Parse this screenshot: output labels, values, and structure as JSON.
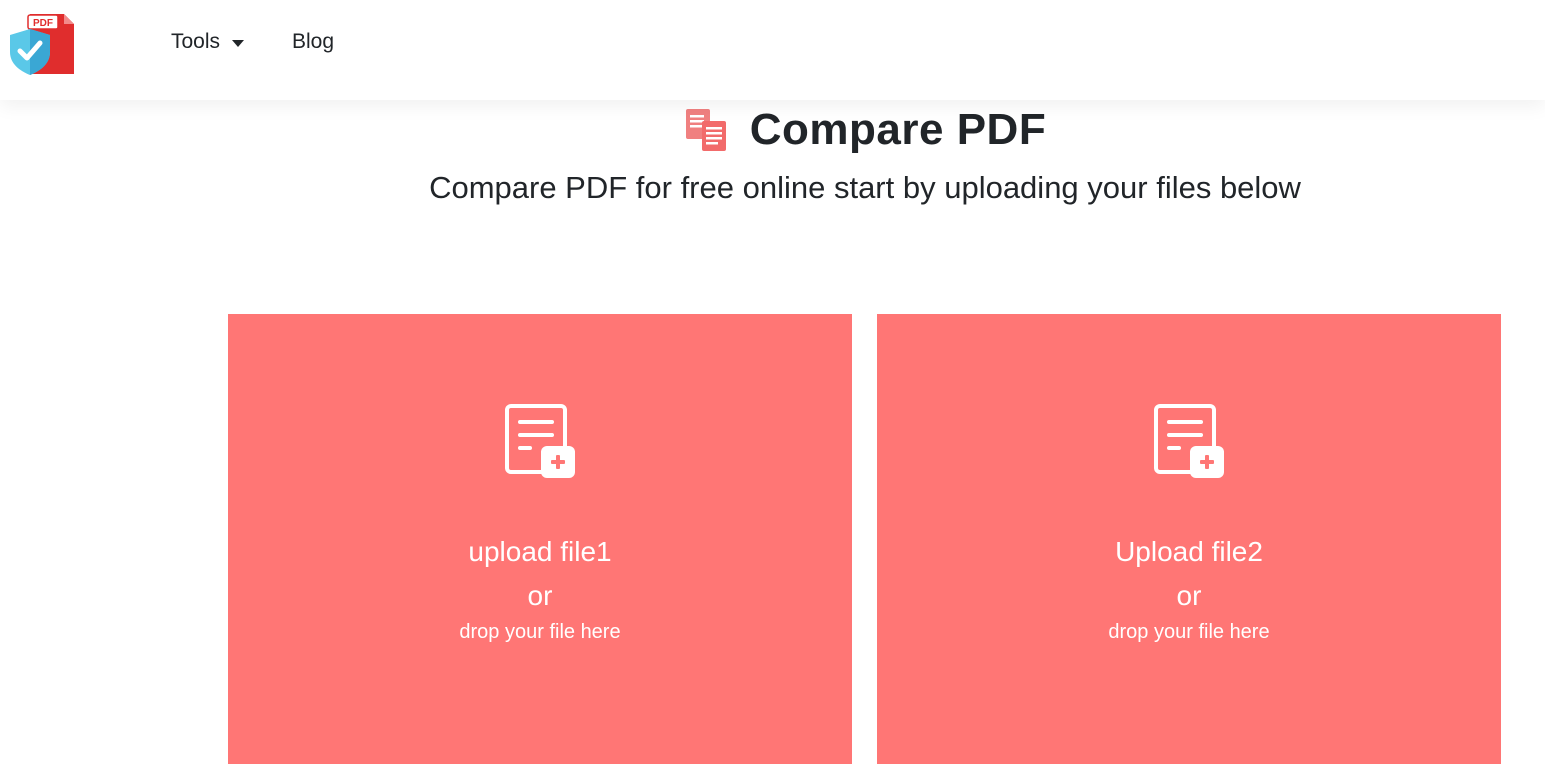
{
  "nav": {
    "logo_text": "PDF",
    "tools_label": "Tools",
    "blog_label": "Blog"
  },
  "header": {
    "title": "Compare PDF",
    "subtitle": "Compare PDF for free online start by uploading your files below"
  },
  "uploads": [
    {
      "label": "upload file1",
      "or": "or",
      "drop": "drop your file here"
    },
    {
      "label": "Upload file2",
      "or": "or",
      "drop": "drop your file here"
    }
  ],
  "colors": {
    "accent": "#ff7675",
    "logo_red": "#e02d2d",
    "shield_blue": "#5ac8e8"
  },
  "icons": {
    "logo": "pdf-shield-icon",
    "tools_caret": "caret-down-icon",
    "title": "copy-documents-icon",
    "upload": "file-add-icon"
  }
}
